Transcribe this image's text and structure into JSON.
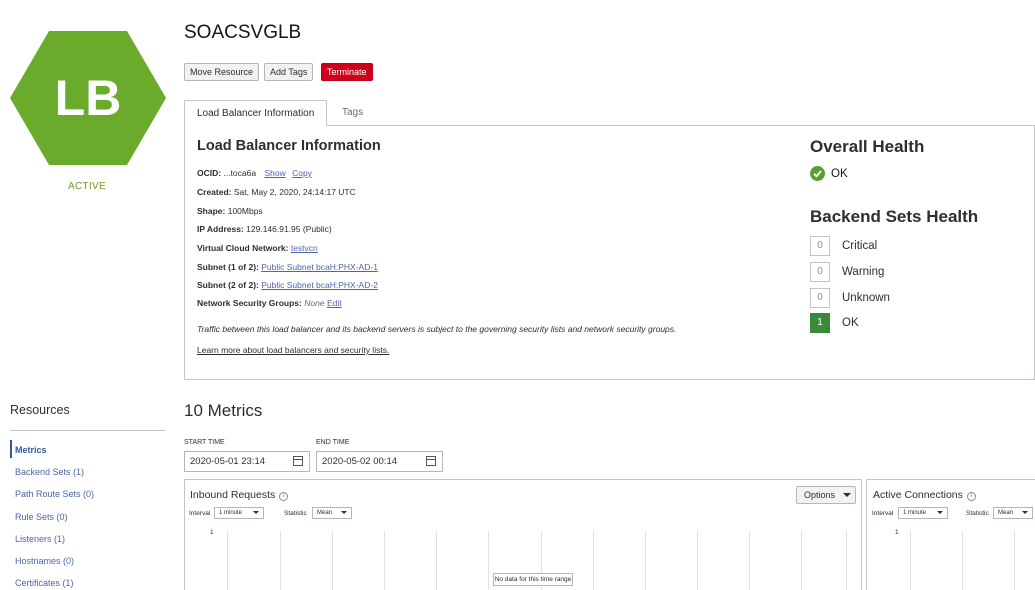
{
  "badge": {
    "text": "LB",
    "status": "ACTIVE",
    "color": "#6bab2c"
  },
  "header": {
    "title": "SOACSVGLB",
    "buttons": {
      "move": "Move Resource",
      "tags": "Add Tags",
      "terminate": "Terminate"
    }
  },
  "tabs": {
    "info": "Load Balancer Information",
    "tags": "Tags"
  },
  "info": {
    "heading": "Load Balancer Information",
    "ocid_label": "OCID:",
    "ocid_value": "...toca6a",
    "ocid_show": "Show",
    "ocid_copy": "Copy",
    "created_label": "Created:",
    "created_value": "Sat, May 2, 2020, 24:14:17 UTC",
    "shape_label": "Shape:",
    "shape_value": "100Mbps",
    "ip_label": "IP Address:",
    "ip_value": "129.146.91.95 (Public)",
    "vcn_label": "Virtual Cloud Network:",
    "vcn_value": "testvcn",
    "subnet1_label": "Subnet (1 of 2):",
    "subnet1_value": "Public Subnet bcaH:PHX-AD-1",
    "subnet2_label": "Subnet (2 of 2):",
    "subnet2_value": "Public Subnet bcaH:PHX-AD-2",
    "nsg_label": "Network Security Groups:",
    "nsg_value": "None",
    "nsg_edit": "Edit",
    "note": "Traffic between this load balancer and its backend servers is subject to the governing security lists and network security groups.",
    "learn_more": "Learn more about load balancers and security lists."
  },
  "health": {
    "overall_heading": "Overall Health",
    "overall_status": "OK",
    "backend_heading": "Backend Sets Health",
    "items": [
      {
        "count": "0",
        "label": "Critical"
      },
      {
        "count": "0",
        "label": "Warning"
      },
      {
        "count": "0",
        "label": "Unknown"
      },
      {
        "count": "1",
        "label": "OK"
      }
    ]
  },
  "resources": {
    "title": "Resources",
    "items": [
      "Metrics",
      "Backend Sets (1)",
      "Path Route Sets (0)",
      "Rule Sets (0)",
      "Listeners (1)",
      "Hostnames (0)",
      "Certificates (1)"
    ]
  },
  "metrics": {
    "title": "10 Metrics",
    "start_label": "START TIME",
    "start_value": "2020-05-01 23:14",
    "end_label": "END TIME",
    "end_value": "2020-05-02 00:14",
    "charts": [
      {
        "title": "Inbound Requests",
        "options": "Options",
        "interval_label": "Interval",
        "interval_value": "1 minute",
        "statistic_label": "Statistic",
        "statistic_value": "Mean",
        "y_tick": "1",
        "no_data": "No data for this time range"
      },
      {
        "title": "Active Connections",
        "interval_label": "Interval",
        "interval_value": "1 minute",
        "statistic_label": "Statistic",
        "statistic_value": "Mean",
        "y_tick": "1"
      }
    ]
  },
  "colors": {
    "terminate": "#d0021b",
    "link": "#4a66a8",
    "ok_green": "#3a8a3a"
  }
}
